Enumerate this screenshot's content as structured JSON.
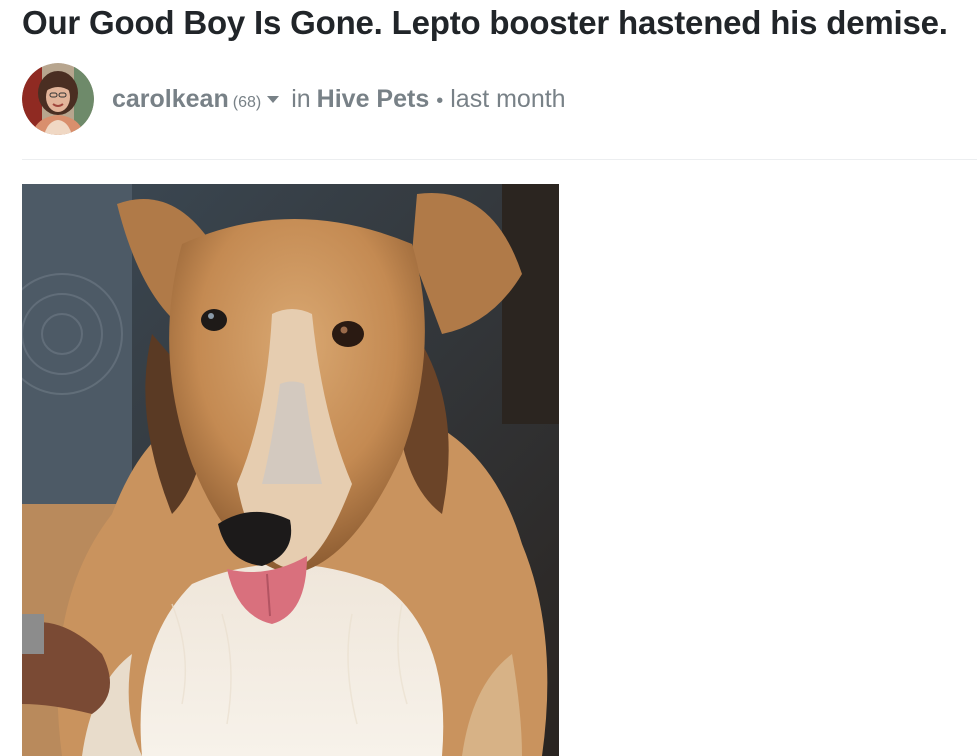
{
  "post": {
    "title": "Our Good Boy Is Gone. Lepto booster hastened his demise."
  },
  "author": {
    "name": "carolkean",
    "reputation": "(68)",
    "in_label": "in",
    "community": "Hive Pets",
    "separator": "•",
    "timestamp": "last month"
  },
  "icons": {
    "caret": "chevron-down-icon"
  }
}
